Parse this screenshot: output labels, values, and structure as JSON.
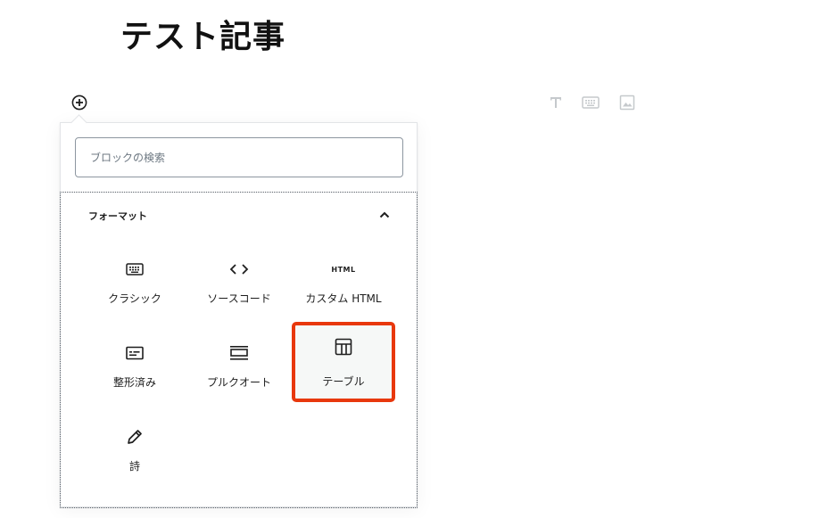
{
  "post": {
    "title": "テスト記事"
  },
  "toolbar": {
    "add_block_icon": "plus-circle-icon",
    "buttons": [
      {
        "name": "heading-icon"
      },
      {
        "name": "keyboard-icon"
      },
      {
        "name": "image-icon"
      }
    ]
  },
  "inserter": {
    "search": {
      "placeholder": "ブロックの検索",
      "value": ""
    },
    "panel": {
      "title": "フォーマット",
      "expanded": true,
      "blocks": [
        {
          "label": "クラシック",
          "icon": "keyboard-icon"
        },
        {
          "label": "ソースコード",
          "icon": "code-icon"
        },
        {
          "label": "カスタム HTML",
          "icon": "html-icon",
          "icon_text": "HTML"
        },
        {
          "label": "整形済み",
          "icon": "preformatted-icon"
        },
        {
          "label": "プルクオート",
          "icon": "pullquote-icon"
        },
        {
          "label": "テーブル",
          "icon": "table-icon",
          "highlighted": true
        },
        {
          "label": "詩",
          "icon": "pencil-icon"
        }
      ]
    }
  },
  "colors": {
    "highlight": "#e8380d",
    "muted_icon": "#c5c9cc",
    "text": "#1e1e1e"
  }
}
